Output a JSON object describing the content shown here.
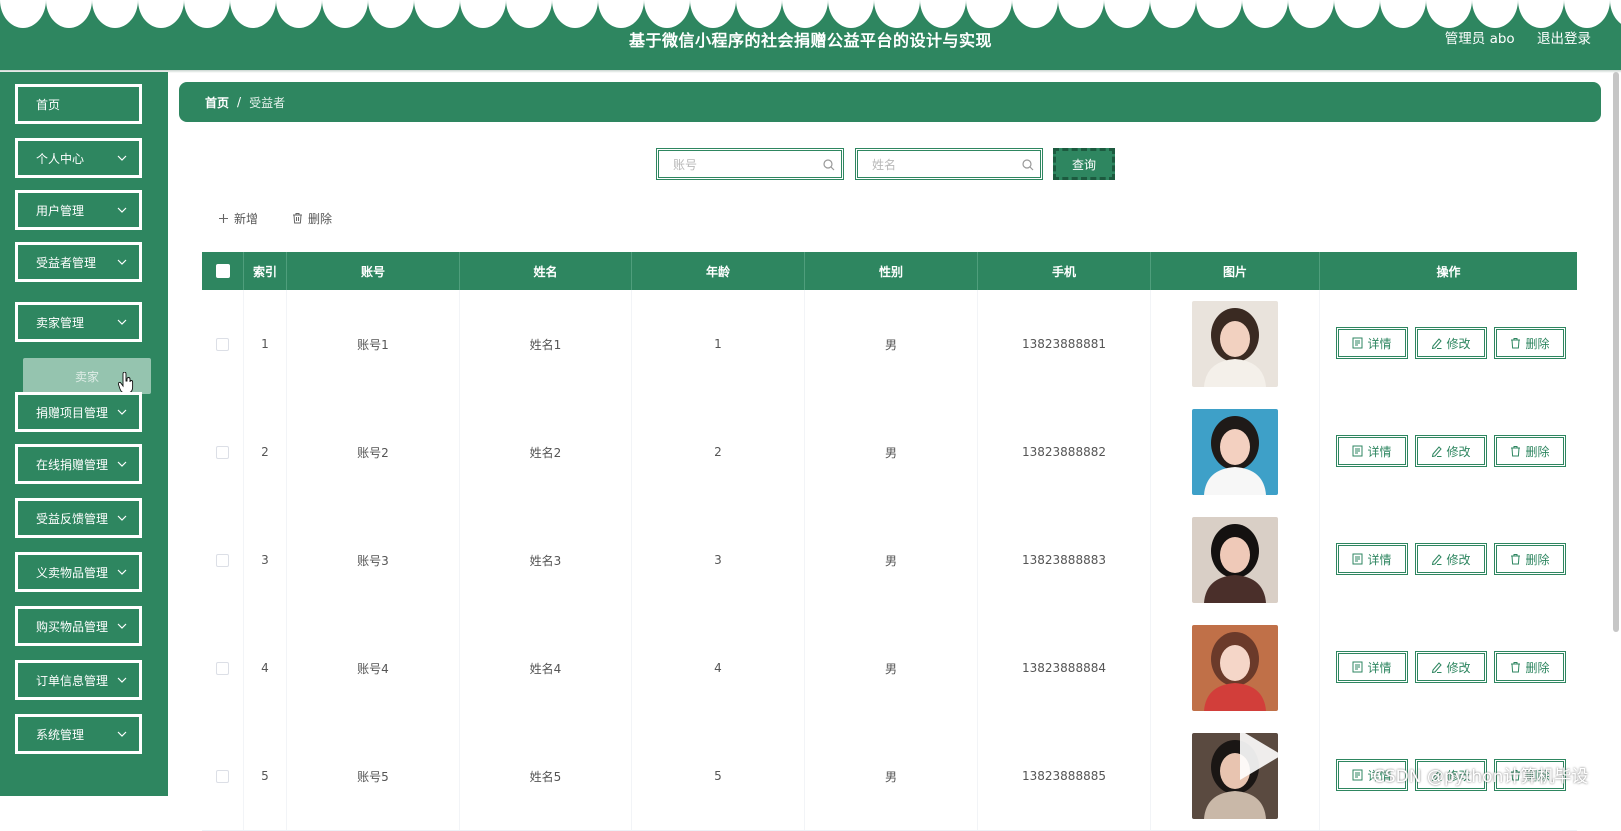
{
  "header": {
    "title": "基于微信小程序的社会捐赠公益平台的设计与实现",
    "user_label": "管理员 abo",
    "logout_label": "退出登录"
  },
  "sidebar": {
    "items": [
      {
        "label": "首页"
      },
      {
        "label": "个人中心"
      },
      {
        "label": "用户管理"
      },
      {
        "label": "受益者管理"
      },
      {
        "label": "卖家管理"
      },
      {
        "label": "捐赠项目管理"
      },
      {
        "label": "在线捐赠管理"
      },
      {
        "label": "受益反馈管理"
      },
      {
        "label": "义卖物品管理"
      },
      {
        "label": "购买物品管理"
      },
      {
        "label": "订单信息管理"
      },
      {
        "label": "系统管理"
      }
    ],
    "sub_item": {
      "label": "卖家"
    }
  },
  "breadcrumb": {
    "home": "首页",
    "separator": "/",
    "current": "受益者"
  },
  "search": {
    "account_placeholder": "账号",
    "name_placeholder": "姓名",
    "query_label": "查询"
  },
  "toolbar": {
    "add_label": "新增",
    "delete_label": "删除"
  },
  "table": {
    "headers": [
      "索引",
      "账号",
      "姓名",
      "年龄",
      "性别",
      "手机",
      "图片",
      "操作"
    ],
    "rows": [
      {
        "index": "1",
        "account": "账号1",
        "name": "姓名1",
        "age": "1",
        "gender": "男",
        "phone": "13823888881"
      },
      {
        "index": "2",
        "account": "账号2",
        "name": "姓名2",
        "age": "2",
        "gender": "男",
        "phone": "13823888882"
      },
      {
        "index": "3",
        "account": "账号3",
        "name": "姓名3",
        "age": "3",
        "gender": "男",
        "phone": "13823888883"
      },
      {
        "index": "4",
        "account": "账号4",
        "name": "姓名4",
        "age": "4",
        "gender": "男",
        "phone": "13823888884"
      },
      {
        "index": "5",
        "account": "账号5",
        "name": "姓名5",
        "age": "5",
        "gender": "男",
        "phone": "13823888885"
      }
    ],
    "actions": {
      "detail": "详情",
      "edit": "修改",
      "delete": "删除"
    }
  },
  "watermark": "CSDN @python计算机毕设",
  "colors": {
    "primary": "#2e8660",
    "submenu": "#a7cfbd",
    "header_text": "#ffffff"
  },
  "icons": [
    "chevron-down-icon",
    "search-icon",
    "plus-icon",
    "trash-icon",
    "document-icon",
    "edit-icon",
    "play-icon",
    "cursor-hand-icon"
  ]
}
